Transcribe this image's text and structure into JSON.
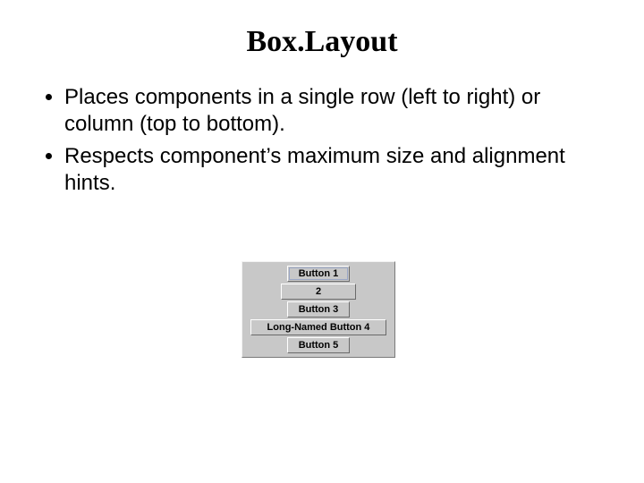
{
  "title": "Box.Layout",
  "bullets": [
    "Places components in a single row (left to right) or column (top to bottom).",
    "Respects component’s maximum size and alignment hints."
  ],
  "example": {
    "buttons": [
      {
        "label": "Button 1"
      },
      {
        "label": "2"
      },
      {
        "label": "Button 3"
      },
      {
        "label": "Long-Named Button 4"
      },
      {
        "label": "Button 5"
      }
    ]
  }
}
